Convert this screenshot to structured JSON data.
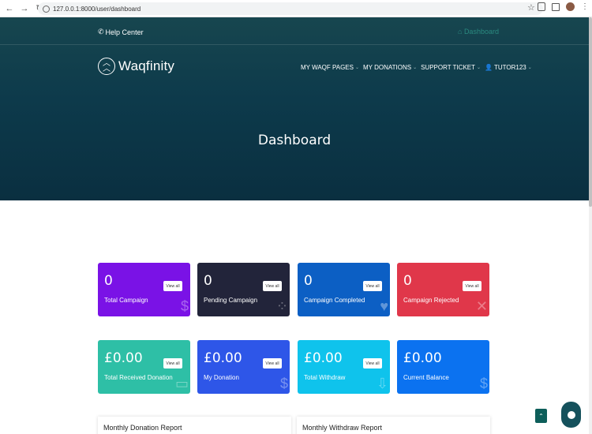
{
  "browser": {
    "url": "127.0.0.1:8000/user/dashboard"
  },
  "topbar": {
    "help": "Help Center",
    "breadcrumb": "Dashboard"
  },
  "logo": "Waqfinity",
  "menu": [
    {
      "label": "MY WAQF PAGES"
    },
    {
      "label": "MY DONATIONS"
    },
    {
      "label": "SUPPORT TICKET"
    },
    {
      "label": "TUTOR123"
    }
  ],
  "hero_title": "Dashboard",
  "cards": [
    {
      "value": "0",
      "label": "Total Campaign",
      "button": "View all",
      "icon": "dollar-hand-icon",
      "color": "#7a12e6"
    },
    {
      "value": "0",
      "label": "Pending Campaign",
      "button": "View all",
      "icon": "spinner-icon",
      "color": "#22243a"
    },
    {
      "value": "0",
      "label": "Campaign Completed",
      "button": "View all",
      "icon": "heart-hand-icon",
      "color": "#0c5fc4"
    },
    {
      "value": "0",
      "label": "Campaign Rejected",
      "button": "View all",
      "icon": "x-icon",
      "color": "#e0374a"
    },
    {
      "value": "£0.00",
      "label": "Total Received Donation",
      "button": "View all",
      "icon": "wallet-icon",
      "color": "#2ebfa6"
    },
    {
      "value": "£0.00",
      "label": "My Donation",
      "button": "View all",
      "icon": "money-icon",
      "color": "#2e56e8"
    },
    {
      "value": "£0.00",
      "label": "Total Withdraw",
      "button": "View all",
      "icon": "withdraw-icon",
      "color": "#0fc3ec"
    },
    {
      "value": "£0.00",
      "label": "Current Balance",
      "icon": "dollar-icon",
      "color": "#0b72f0"
    }
  ],
  "panels": [
    {
      "title": "Monthly Donation Report"
    },
    {
      "title": "Monthly Withdraw Report"
    }
  ]
}
